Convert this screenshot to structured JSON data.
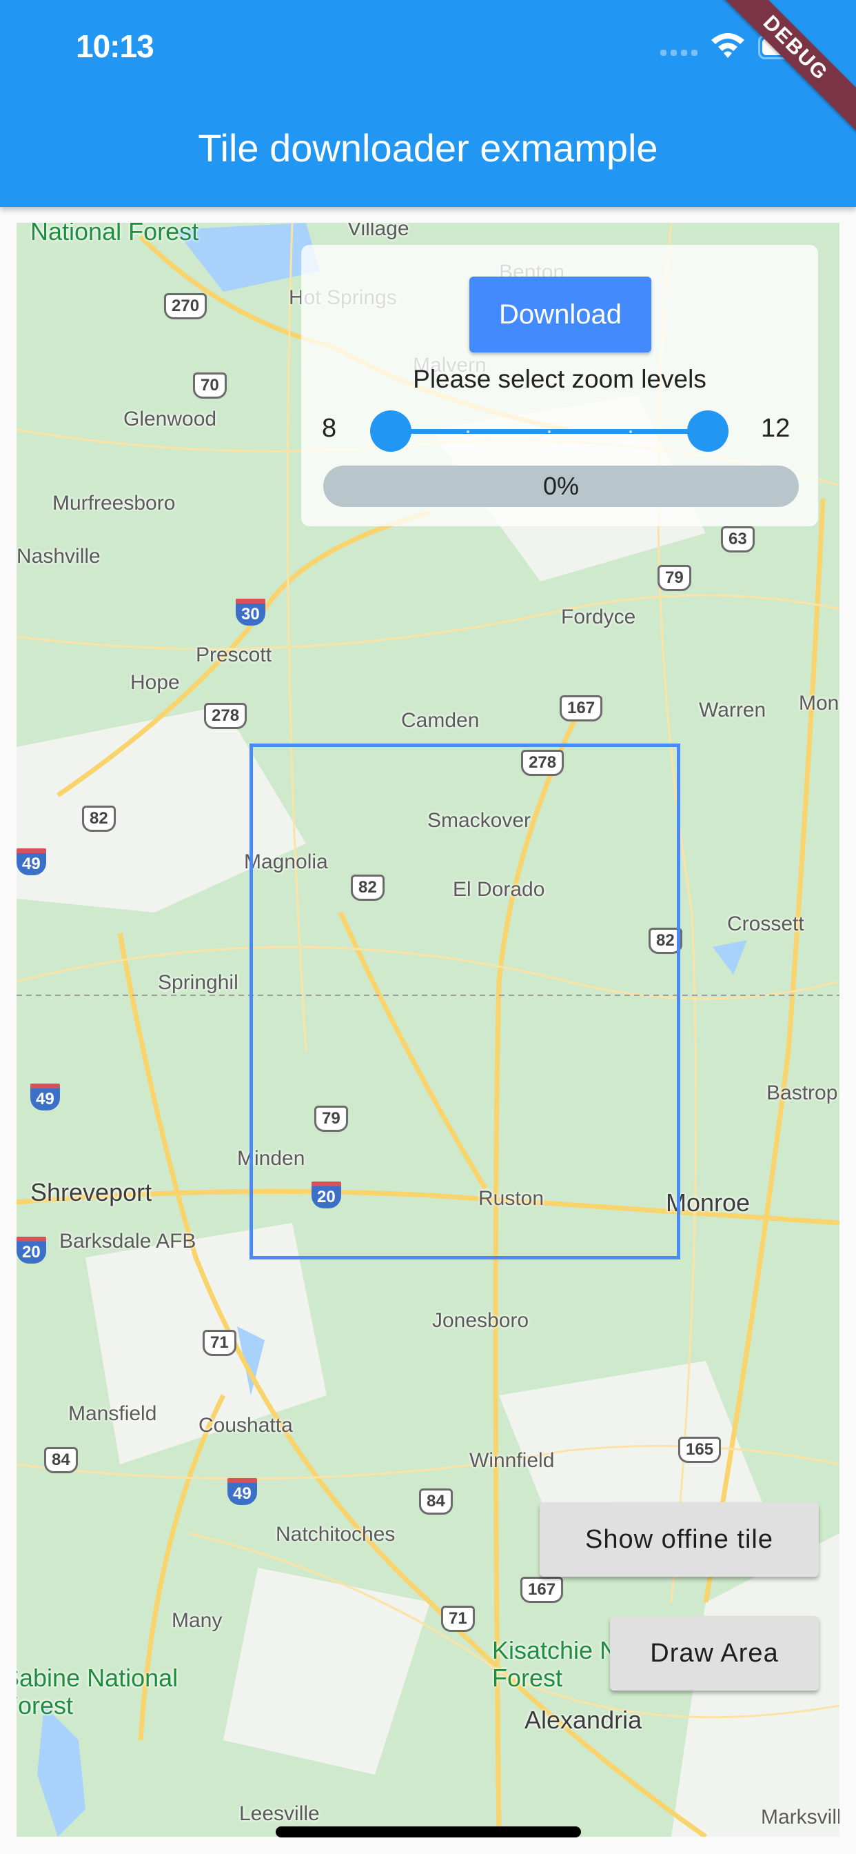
{
  "status_bar": {
    "time": "10:13",
    "wifi_icon": "wifi-icon",
    "battery_icon": "battery-icon",
    "signal_icon": "signal-icon"
  },
  "app_bar": {
    "title": "Tile downloader exmample"
  },
  "debug_banner": "DEBUG",
  "panel": {
    "download_label": "Download",
    "zoom_label": "Please select zoom levels",
    "range_min": "8",
    "range_max": "12",
    "slider": {
      "min": 8,
      "max": 12,
      "start": 8,
      "end": 12,
      "divisions": 4
    },
    "progress": {
      "value": 0,
      "label": "0%"
    }
  },
  "buttons": {
    "show_offline": "Show offine tile",
    "draw_area": "Draw Area"
  },
  "colors": {
    "primary": "#2196f3",
    "accent": "#448aff",
    "selection": "#4a8af4",
    "progress_bg": "#b8c6cb"
  },
  "map": {
    "places": [
      {
        "name": "National Forest",
        "type": "forest"
      },
      {
        "name": "Village"
      },
      {
        "name": "Hot Springs"
      },
      {
        "name": "Benton"
      },
      {
        "name": "Malvern"
      },
      {
        "name": "Glenwood"
      },
      {
        "name": "Murfreesboro"
      },
      {
        "name": "Nashville"
      },
      {
        "name": "Prescott"
      },
      {
        "name": "Hope"
      },
      {
        "name": "Fordyce"
      },
      {
        "name": "Camden"
      },
      {
        "name": "Warren"
      },
      {
        "name": "Monti"
      },
      {
        "name": "Smackover"
      },
      {
        "name": "Magnolia"
      },
      {
        "name": "El Dorado"
      },
      {
        "name": "Crossett"
      },
      {
        "name": "Springhil"
      },
      {
        "name": "Bastrop"
      },
      {
        "name": "Minden"
      },
      {
        "name": "Shreveport",
        "type": "big"
      },
      {
        "name": "Barksdale AFB"
      },
      {
        "name": "Ruston"
      },
      {
        "name": "Monroe",
        "type": "big"
      },
      {
        "name": "Jonesboro"
      },
      {
        "name": "Mansfield"
      },
      {
        "name": "Coushatta"
      },
      {
        "name": "Winnfield"
      },
      {
        "name": "Natchitoches"
      },
      {
        "name": "Many"
      },
      {
        "name": "Kisatchie National Forest",
        "type": "forest"
      },
      {
        "name": "Sabine National Forest",
        "type": "forest"
      },
      {
        "name": "Alexandria",
        "type": "big"
      },
      {
        "name": "Leesville"
      },
      {
        "name": "Marksville"
      }
    ],
    "shields": [
      "270",
      "70",
      "63",
      "79",
      "30",
      "278",
      "167",
      "278",
      "82",
      "82",
      "82",
      "49",
      "79",
      "20",
      "71",
      "165",
      "84",
      "49",
      "84",
      "167",
      "71"
    ],
    "interstates": [
      "30",
      "49",
      "20",
      "49",
      "49",
      "20"
    ]
  }
}
